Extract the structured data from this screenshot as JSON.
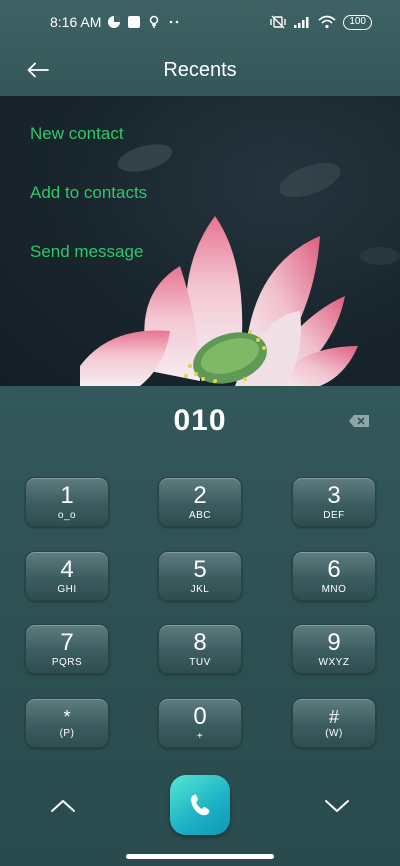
{
  "status_bar": {
    "time": "8:16 AM",
    "battery": "100",
    "icons": [
      "data-saver-icon",
      "stop-icon",
      "location-icon",
      "more-dots-icon",
      "vibrate-off-icon",
      "signal-icon",
      "wifi-icon",
      "battery-icon"
    ]
  },
  "header": {
    "title": "Recents",
    "back_icon": "arrow-left-icon"
  },
  "menu": {
    "items": [
      "New contact",
      "Add to contacts",
      "Send message"
    ]
  },
  "dialer": {
    "number": "010",
    "keys": [
      {
        "digit": "1",
        "letters": "ᴏ_ᴏ"
      },
      {
        "digit": "2",
        "letters": "ABC"
      },
      {
        "digit": "3",
        "letters": "DEF"
      },
      {
        "digit": "4",
        "letters": "GHI"
      },
      {
        "digit": "5",
        "letters": "JKL"
      },
      {
        "digit": "6",
        "letters": "MNO"
      },
      {
        "digit": "7",
        "letters": "PQRS"
      },
      {
        "digit": "8",
        "letters": "TUV"
      },
      {
        "digit": "9",
        "letters": "WXYZ"
      },
      {
        "digit": "*",
        "letters": "(P)"
      },
      {
        "digit": "0",
        "letters": "+"
      },
      {
        "digit": "#",
        "letters": "(W)"
      }
    ]
  },
  "colors": {
    "accent_green": "#2ec86a",
    "header_bg": "#3e6364",
    "dialer_bg": "#2f5255",
    "call_button": "#1bb0c5"
  }
}
